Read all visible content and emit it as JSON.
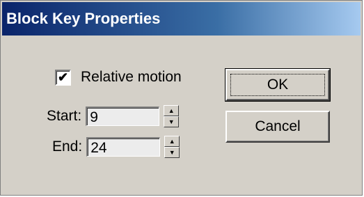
{
  "window": {
    "title": "Block Key Properties"
  },
  "relative_motion": {
    "label": "Relative motion",
    "checked": true
  },
  "start": {
    "label": "Start:",
    "value": "9"
  },
  "end": {
    "label": "End:",
    "value": "24"
  },
  "buttons": {
    "ok_label": "OK",
    "cancel_label": "Cancel"
  }
}
